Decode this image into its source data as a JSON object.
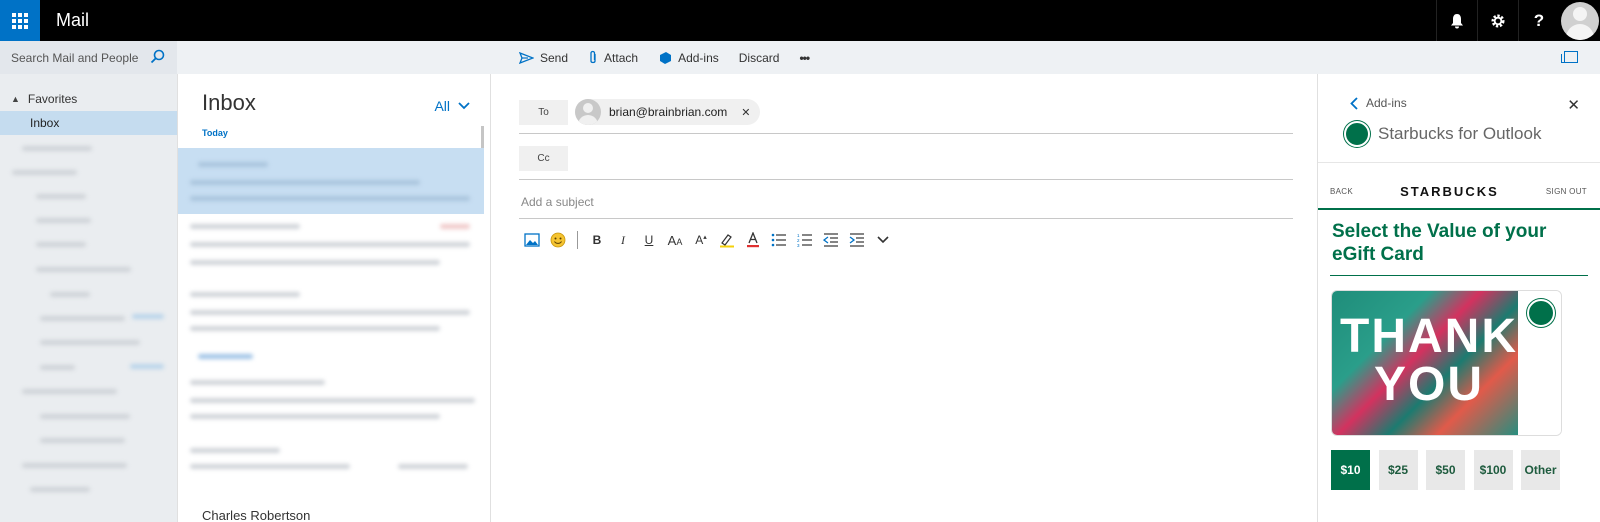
{
  "app": {
    "title": "Mail"
  },
  "topbar": {
    "icons": [
      "bell-icon",
      "gear-icon",
      "help-icon"
    ],
    "help_glyph": "?"
  },
  "search": {
    "placeholder": "Search Mail and People"
  },
  "commands": {
    "send": "Send",
    "attach": "Attach",
    "addins": "Add-ins",
    "discard": "Discard",
    "more": "•••"
  },
  "nav": {
    "favorites_label": "Favorites",
    "inbox_label": "Inbox"
  },
  "message_list": {
    "title": "Inbox",
    "filter": "All",
    "group_today": "Today",
    "last_sender": "Charles Robertson"
  },
  "compose": {
    "to_label": "To",
    "cc_label": "Cc",
    "recipient": "brian@brainbrian.com",
    "subject_placeholder": "Add a subject"
  },
  "addin": {
    "back_label": "Add-ins",
    "title": "Starbucks for Outlook",
    "nav_back": "BACK",
    "brand": "STARBUCKS",
    "nav_signout": "SIGN OUT",
    "heading": "Select the Value of your eGift Card",
    "card_line1": "THANK",
    "card_line2": "YOU",
    "values": [
      "$10",
      "$25",
      "$50",
      "$100",
      "Other"
    ],
    "selected_value": "$10",
    "accent_color": "#00704a"
  },
  "colors": {
    "brand_blue": "#0072c6",
    "selection": "#c7def2"
  }
}
